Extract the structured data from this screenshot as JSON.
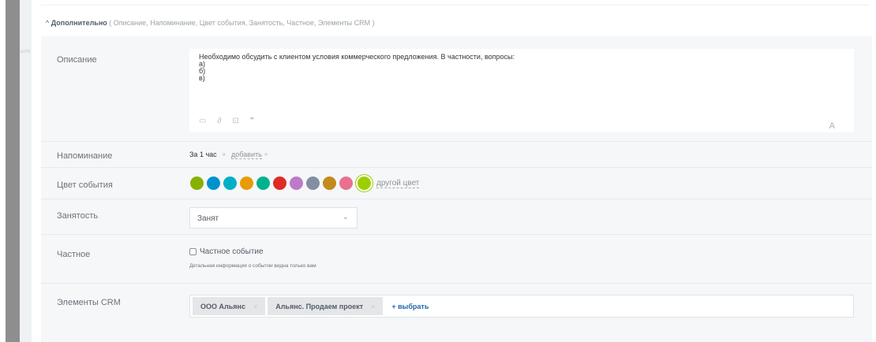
{
  "sidebar": {
    "ghost_text": "ыта"
  },
  "section": {
    "title": "Дополнительно",
    "fields_list": "( Описание,  Напоминание,  Цвет события,  Занятость,  Частное,  Элементы CRM )"
  },
  "description": {
    "label": "Описание",
    "text": "Необходимо обсудить с клиентом условия коммерческого предложения. В частности, вопросы:\nа)\nб)\nв)",
    "tools": [
      "video-icon",
      "link-icon",
      "camera-icon",
      "quote-icon"
    ],
    "font_button": "A"
  },
  "reminder": {
    "label": "Напоминание",
    "value": "За 1 час",
    "remove": "×",
    "add": "добавить",
    "add_plus": "+"
  },
  "color": {
    "label": "Цвет события",
    "swatches": [
      "#86b100",
      "#0092cc",
      "#00afc7",
      "#e89b06",
      "#00b38c",
      "#de2b24",
      "#bd7ac9",
      "#838fa0",
      "#c38a1d",
      "#e97090"
    ],
    "selected": "#9dcf00",
    "other": "другой цвет"
  },
  "busy": {
    "label": "Занятость",
    "value": "Занят",
    "chevron": "⌄"
  },
  "private": {
    "label": "Частное",
    "checkbox_label": "Частное событие",
    "hint": "Детальная информация о событии видна только вам"
  },
  "crm": {
    "label": "Элементы CRM",
    "tags": [
      {
        "label": "ООО Альянс",
        "remove": "×"
      },
      {
        "label": "Альянс. Продаем проект",
        "remove": "×"
      }
    ],
    "select": "+ выбрать"
  }
}
